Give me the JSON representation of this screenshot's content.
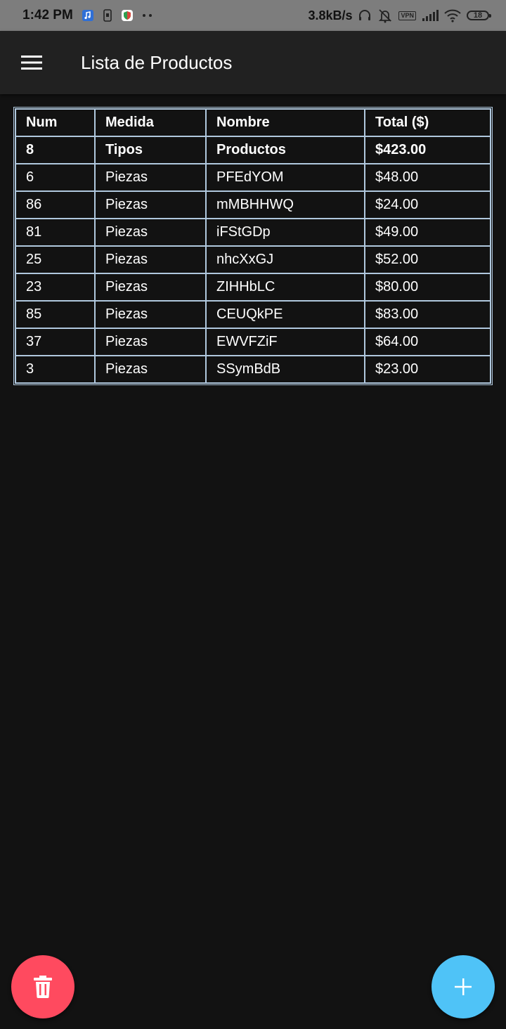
{
  "status_bar": {
    "time": "1:42 PM",
    "speed": "3.8kB/s",
    "vpn": "VPN",
    "battery": "18",
    "icons": [
      "music-app-icon",
      "screenshot-icon",
      "security-app-icon",
      "more-dots-icon",
      "headphones-icon",
      "alarm-off-icon",
      "vpn-icon",
      "signal-icon",
      "wifi-icon",
      "battery-icon"
    ]
  },
  "app_bar": {
    "title": "Lista de Productos",
    "menu_icon": "menu-icon"
  },
  "table": {
    "headers": [
      "Num",
      "Medida",
      "Nombre",
      "Total ($)"
    ],
    "summary": [
      "8",
      "Tipos",
      "Productos",
      "$423.00"
    ],
    "rows": [
      [
        "6",
        "Piezas",
        "PFEdYOM",
        "$48.00"
      ],
      [
        "86",
        "Piezas",
        "mMBHHWQ",
        "$24.00"
      ],
      [
        "81",
        "Piezas",
        "iFStGDp",
        "$49.00"
      ],
      [
        "25",
        "Piezas",
        "nhcXxGJ",
        "$52.00"
      ],
      [
        "23",
        "Piezas",
        "ZIHHbLC",
        "$80.00"
      ],
      [
        "85",
        "Piezas",
        "CEUQkPE",
        "$83.00"
      ],
      [
        "37",
        "Piezas",
        "EWVFZiF",
        "$64.00"
      ],
      [
        "3",
        "Piezas",
        "SSymBdB",
        "$23.00"
      ]
    ]
  },
  "fabs": {
    "delete_icon": "trash-icon",
    "add_icon": "plus-icon",
    "delete_color": "#ff4a5f",
    "add_color": "#4fc3f7"
  },
  "colors": {
    "background": "#121212",
    "app_bar": "#212121",
    "status_bar": "#7d7d7d",
    "table_border": "#b0c8de"
  }
}
